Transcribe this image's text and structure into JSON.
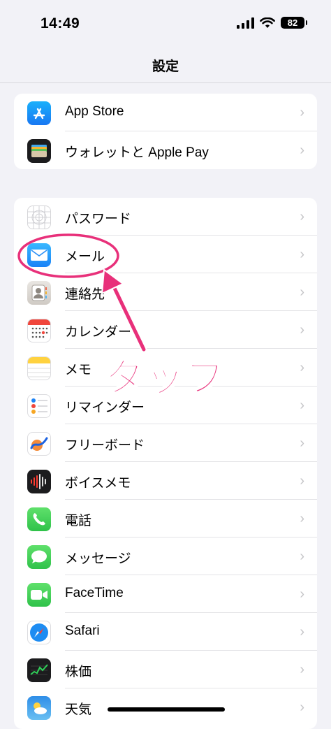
{
  "status": {
    "time": "14:49",
    "battery": "82"
  },
  "nav": {
    "title": "設定"
  },
  "group1": [
    {
      "label": "App Store",
      "icon": "app-store-icon"
    },
    {
      "label": "ウォレットと Apple Pay",
      "icon": "wallet-icon"
    }
  ],
  "group2": [
    {
      "label": "パスワード",
      "icon": "passwords-icon"
    },
    {
      "label": "メール",
      "icon": "mail-icon"
    },
    {
      "label": "連絡先",
      "icon": "contacts-icon"
    },
    {
      "label": "カレンダー",
      "icon": "calendar-icon"
    },
    {
      "label": "メモ",
      "icon": "notes-icon"
    },
    {
      "label": "リマインダー",
      "icon": "reminders-icon"
    },
    {
      "label": "フリーボード",
      "icon": "freeform-icon"
    },
    {
      "label": "ボイスメモ",
      "icon": "voice-memos-icon"
    },
    {
      "label": "電話",
      "icon": "phone-icon"
    },
    {
      "label": "メッセージ",
      "icon": "messages-icon"
    },
    {
      "label": "FaceTime",
      "icon": "facetime-icon"
    },
    {
      "label": "Safari",
      "icon": "safari-icon"
    },
    {
      "label": "株価",
      "icon": "stocks-icon"
    },
    {
      "label": "天気",
      "icon": "weather-icon"
    }
  ],
  "annotation": {
    "text": "タップ",
    "color": "#e8307a"
  }
}
